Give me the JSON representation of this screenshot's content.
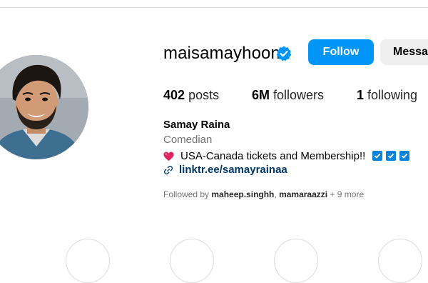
{
  "profile": {
    "username": "maisamayhoon",
    "verified": true,
    "buttons": {
      "follow": "Follow",
      "message": "Message"
    },
    "stats": [
      {
        "count": "402",
        "label": "posts"
      },
      {
        "count": "6M",
        "label": "followers"
      },
      {
        "count": "1",
        "label": "following"
      }
    ],
    "full_name": "Samay Raina",
    "category": "Comedian",
    "bio": "USA-Canada tickets and Membership!!",
    "link": "linktr.ee/samayrainaa",
    "followed_by": {
      "prefix": "Followed by",
      "users": [
        "maheep.singhh",
        "mamaraazzi"
      ],
      "more": "+ 9 more"
    }
  },
  "icons": {
    "verified": "verified-badge-icon",
    "heart": "red-heart-icon",
    "check": "check-mark-button-icon",
    "link": "link-icon"
  },
  "colors": {
    "primary_button": "#0095f6",
    "secondary_button": "#efefef",
    "verified_blue": "#0095f6",
    "link": "#00376b",
    "muted": "#737373"
  }
}
